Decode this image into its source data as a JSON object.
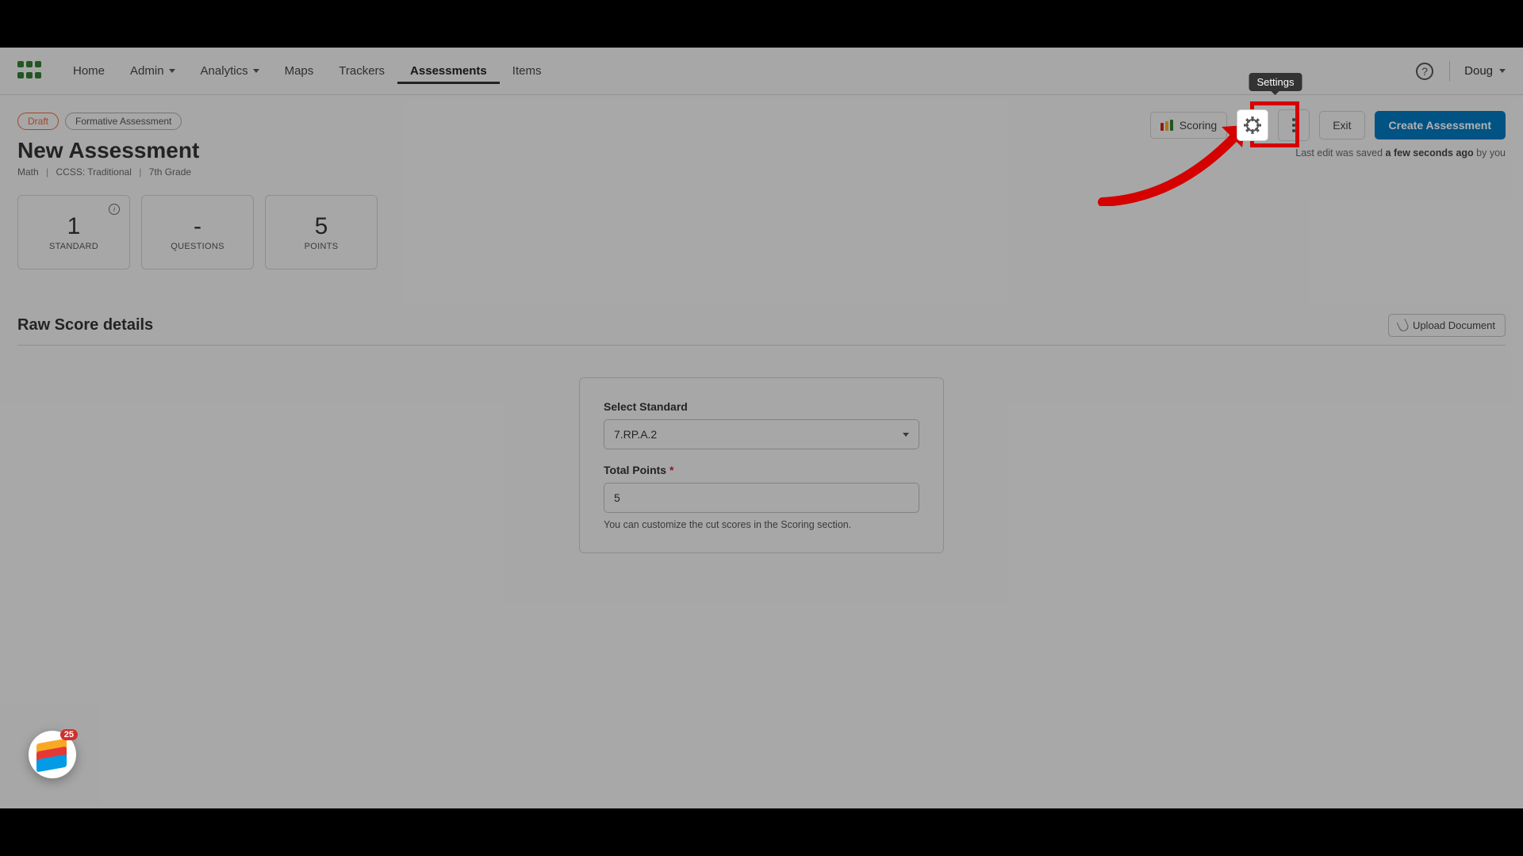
{
  "nav": {
    "items": [
      "Home",
      "Admin",
      "Analytics",
      "Maps",
      "Trackers",
      "Assessments",
      "Items"
    ],
    "user": "Doug"
  },
  "badges": {
    "status": "Draft",
    "type": "Formative Assessment"
  },
  "page": {
    "title": "New Assessment",
    "meta": {
      "subject": "Math",
      "framework": "CCSS: Traditional",
      "grade": "7th Grade"
    }
  },
  "stats": {
    "standard": {
      "value": "1",
      "label": "STANDARD"
    },
    "questions": {
      "value": "-",
      "label": "QUESTIONS"
    },
    "points": {
      "value": "5",
      "label": "POINTS"
    }
  },
  "section": {
    "title": "Raw Score details",
    "upload": "Upload Document"
  },
  "form": {
    "standard_label": "Select Standard",
    "standard_value": "7.RP.A.2",
    "points_label": "Total Points",
    "points_value": "5",
    "helper": "You can customize the cut scores in the Scoring section."
  },
  "actions": {
    "scoring": "Scoring",
    "exit": "Exit",
    "create": "Create Assessment",
    "settings_tooltip": "Settings"
  },
  "save_note": {
    "prefix": "Last edit was saved ",
    "time": "a few seconds ago",
    "suffix": " by you"
  },
  "widget": {
    "badge": "25"
  }
}
